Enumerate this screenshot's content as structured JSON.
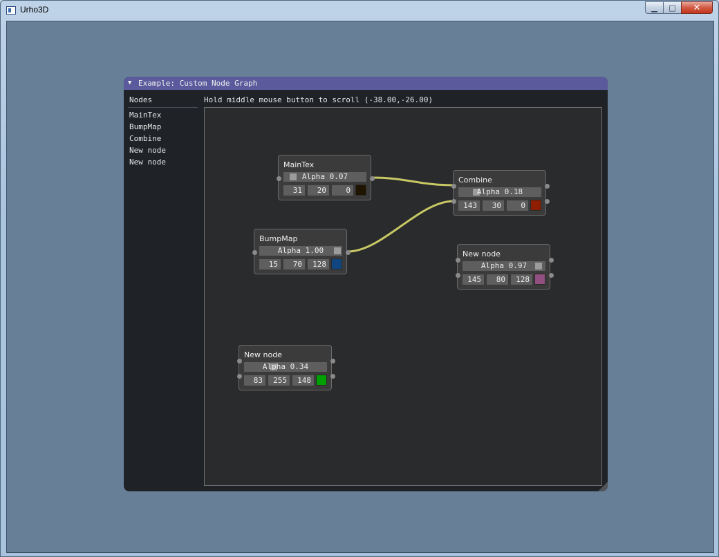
{
  "window": {
    "title": "Urho3D",
    "controls": {
      "minimize": "▁",
      "maximize": "□",
      "close": "✕"
    }
  },
  "imgui": {
    "title": "Example: Custom Node Graph",
    "collapse_arrow": "▼",
    "nodes_panel": {
      "header": "Nodes",
      "items": [
        "MainTex",
        "BumpMap",
        "Combine",
        "New node",
        "New node"
      ]
    },
    "hint": "Hold middle mouse button to scroll (-38.00,-26.00)",
    "nodes": [
      {
        "title": "MainTex",
        "alpha_label": "Alpha 0.07",
        "alpha": 0.07,
        "r": "31",
        "g": "20",
        "b": "0",
        "color": "#1f1400"
      },
      {
        "title": "Combine",
        "alpha_label": "Alpha 0.18",
        "alpha": 0.18,
        "r": "143",
        "g": "30",
        "b": "0",
        "color": "#8f1e00"
      },
      {
        "title": "BumpMap",
        "alpha_label": "Alpha 1.00",
        "alpha": 1.0,
        "r": "15",
        "g": "70",
        "b": "128",
        "color": "#0f4680"
      },
      {
        "title": "New node",
        "alpha_label": "Alpha 0.97",
        "alpha": 0.97,
        "r": "145",
        "g": "80",
        "b": "128",
        "color": "#915080"
      },
      {
        "title": "New node",
        "alpha_label": "Alpha 0.34",
        "alpha": 0.34,
        "r": "83",
        "g": "255",
        "b": "148",
        "color": "#00a000"
      }
    ],
    "link_color": "#c8c864"
  }
}
